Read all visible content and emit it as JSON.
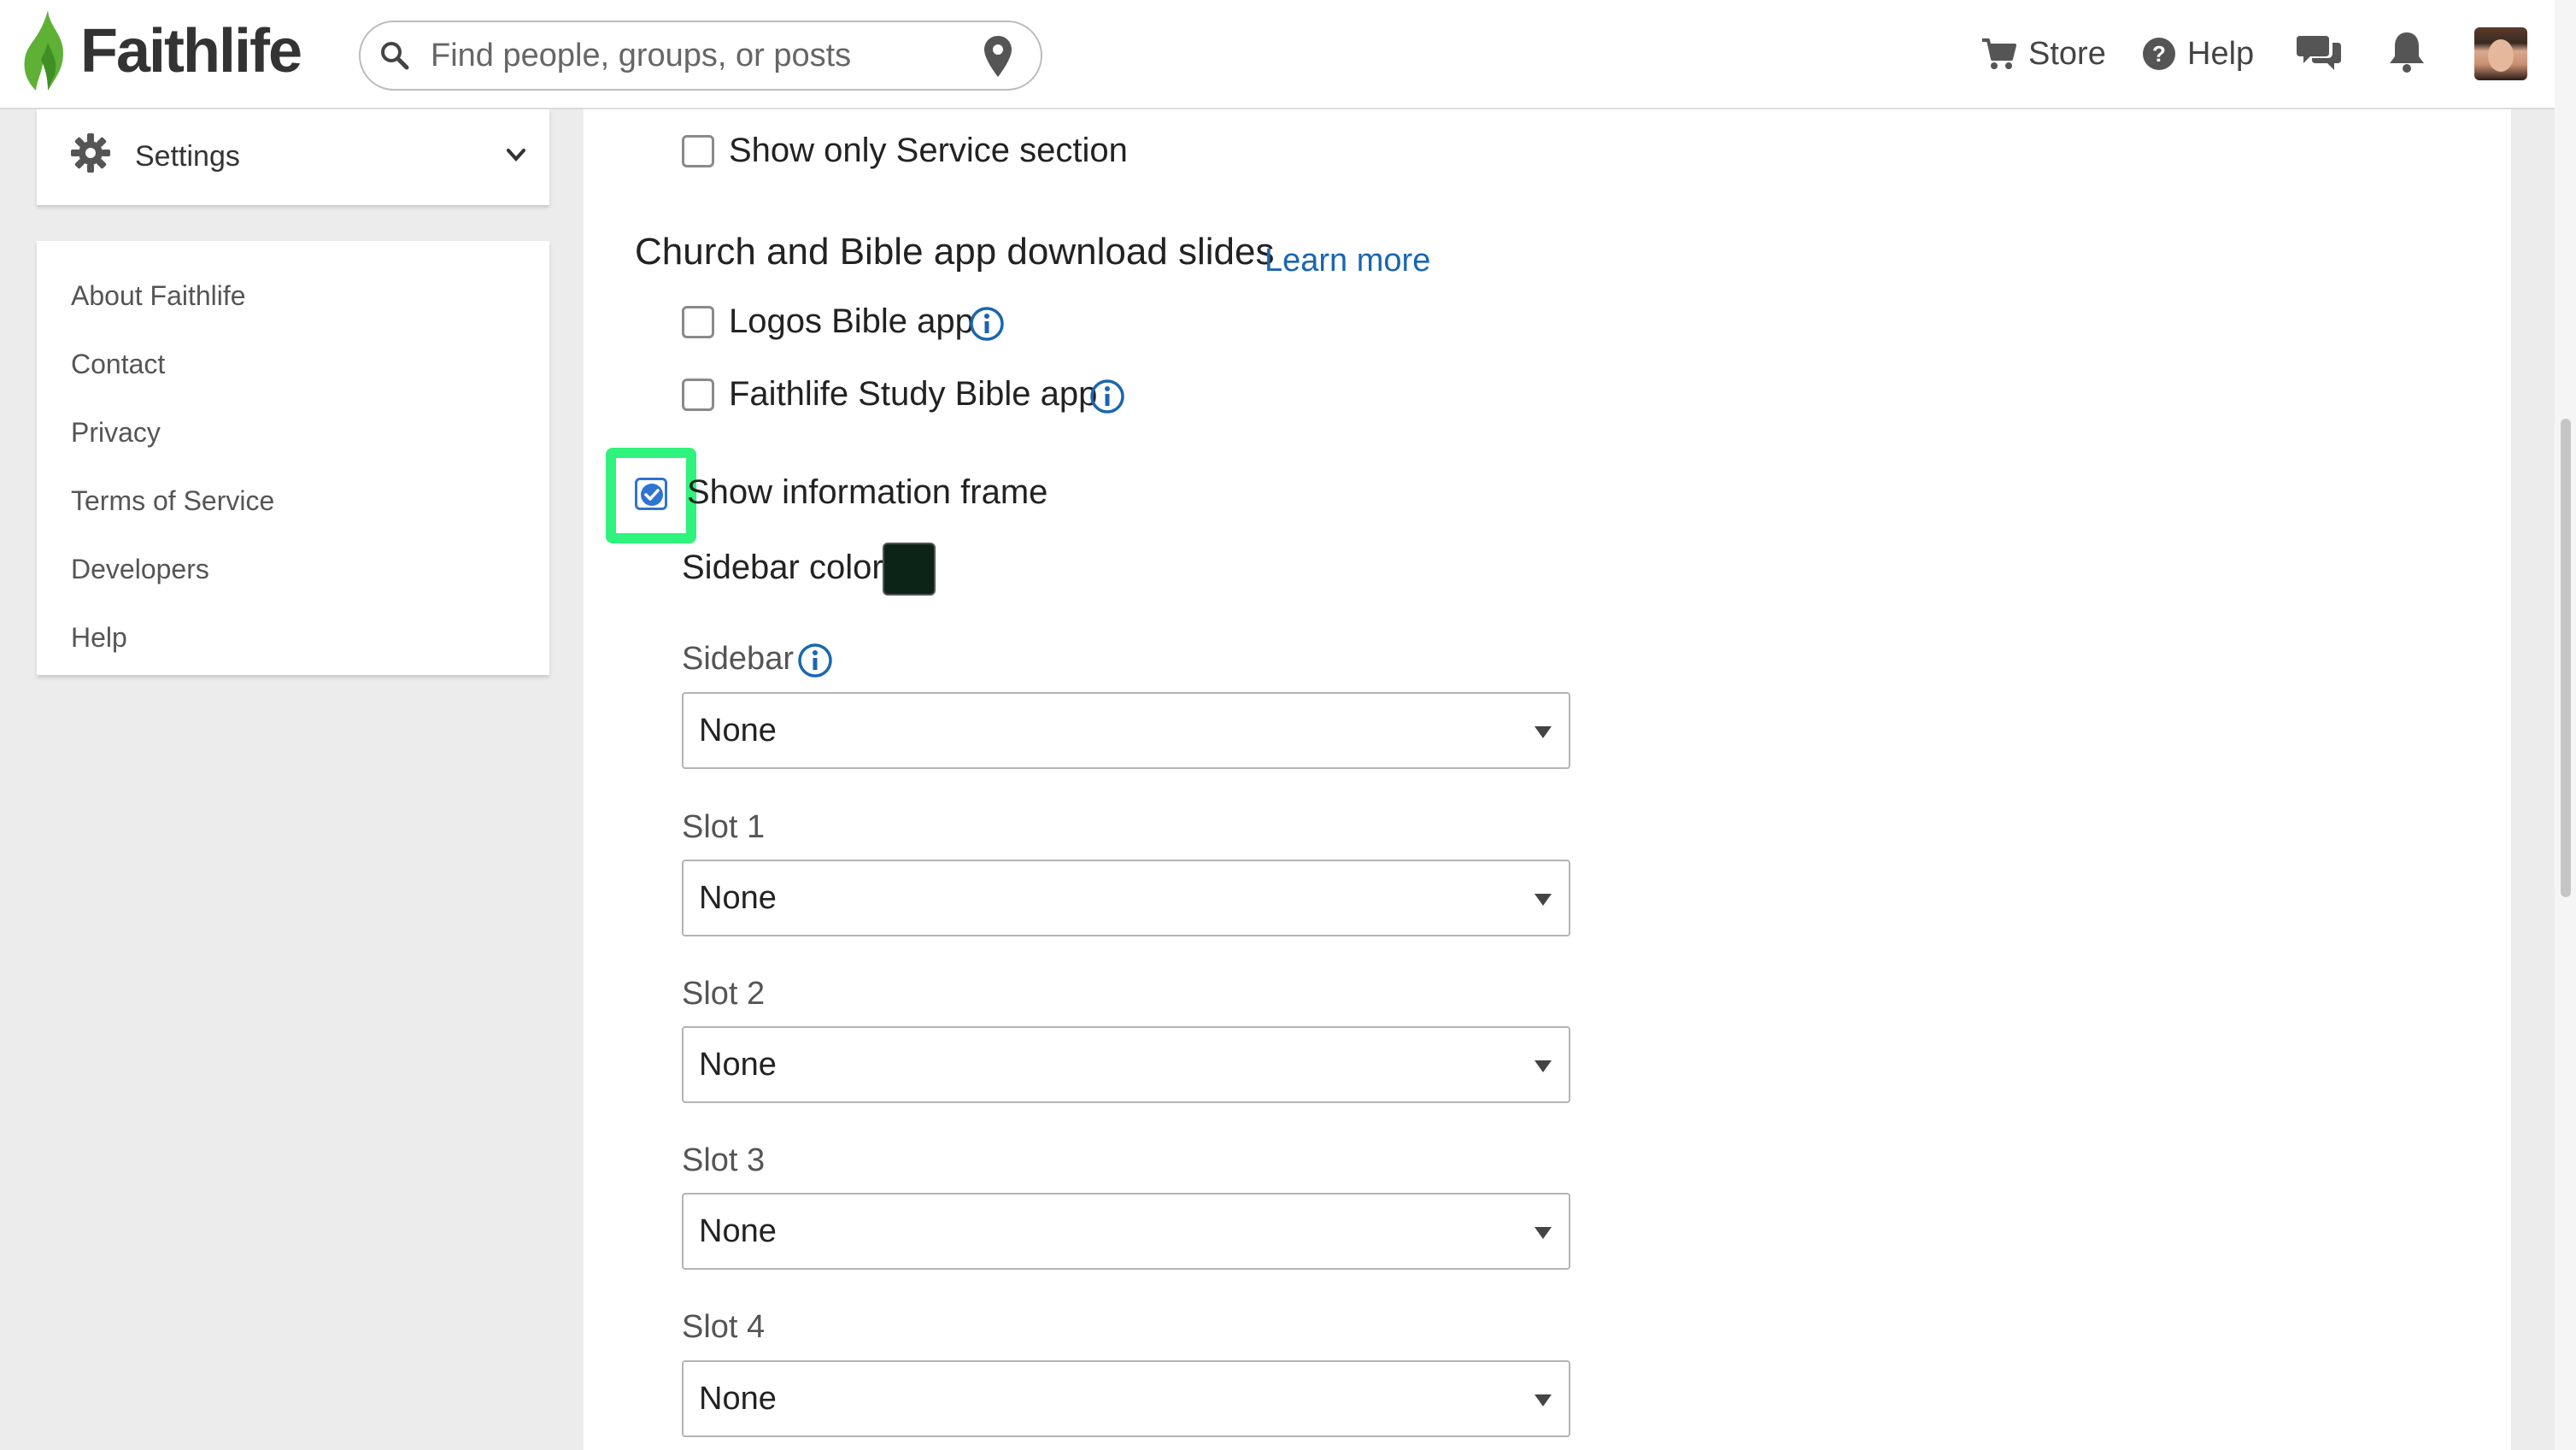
{
  "header": {
    "brand": "Faithlife",
    "search_placeholder": "Find people, groups, or posts",
    "store_label": "Store",
    "help_label": "Help",
    "brand_color": "#5fb136"
  },
  "sidebar": {
    "settings_label": "Settings",
    "links": [
      "About Faithlife",
      "Contact",
      "Privacy",
      "Terms of Service",
      "Developers",
      "Help"
    ]
  },
  "main": {
    "show_service_label": "Show only Service section",
    "download_title": "Church and Bible app download slides",
    "learn_more": "Learn more",
    "logos_app_label": "Logos Bible app",
    "study_app_label": "Faithlife Study Bible app",
    "info_frame_label": "Show information frame",
    "info_frame_checked": true,
    "sidebar_color_label": "Sidebar color",
    "sidebar_color": "#0c2418",
    "fields": [
      {
        "label": "Sidebar",
        "value": "None"
      },
      {
        "label": "Slot 1",
        "value": "None"
      },
      {
        "label": "Slot 2",
        "value": "None"
      },
      {
        "label": "Slot 3",
        "value": "None"
      },
      {
        "label": "Slot 4",
        "value": "None"
      }
    ]
  }
}
